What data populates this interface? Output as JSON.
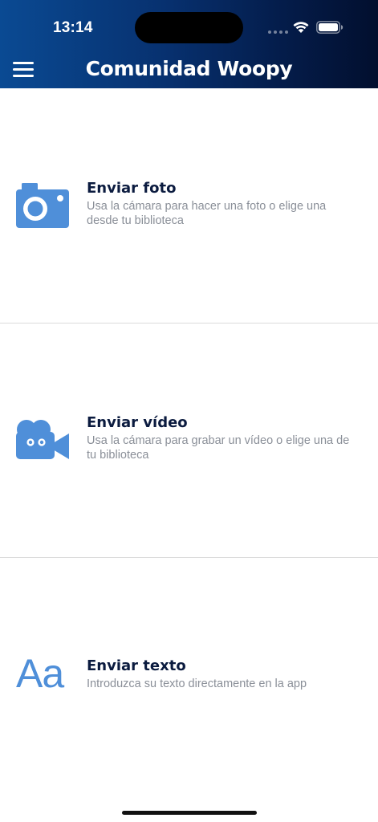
{
  "status_bar": {
    "time": "13:14"
  },
  "header": {
    "title": "Comunidad Woopy"
  },
  "colors": {
    "header_gradient_start": "#0a4a93",
    "header_gradient_end": "#020f2e",
    "icon_blue": "#4f8fd9",
    "title_text": "#0b1b3f",
    "description_text": "#8a8f98"
  },
  "options": [
    {
      "icon": "camera-icon",
      "title": "Enviar foto",
      "description": "Usa la cámara para hacer una foto o elige una desde tu biblioteca"
    },
    {
      "icon": "video-camera-icon",
      "title": "Enviar vídeo",
      "description": "Usa la cámara para grabar un vídeo o elige una de tu biblioteca"
    },
    {
      "icon": "text-icon",
      "icon_text": "Aa",
      "title": "Enviar texto",
      "description": "Introduzca su texto directamente en la app"
    }
  ]
}
